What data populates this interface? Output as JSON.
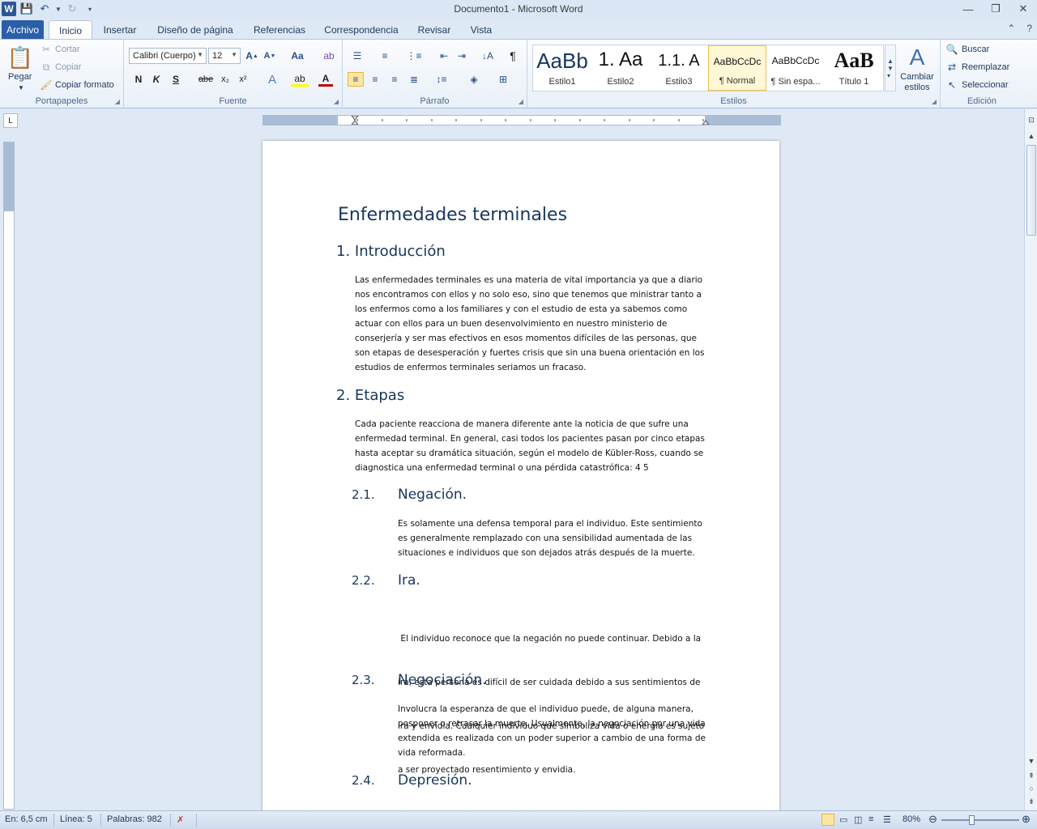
{
  "window": {
    "title": "Documento1 - Microsoft Word"
  },
  "quick_access": {
    "app_icon": "word-icon",
    "save_icon": "save-icon",
    "undo_icon": "undo-icon",
    "redo_icon": "redo-icon",
    "customize_icon": "chevron-down-icon"
  },
  "window_controls": {
    "minimize": "▭",
    "restore": "❐",
    "close": "✕"
  },
  "tabs": [
    {
      "label": "Archivo"
    },
    {
      "label": "Inicio"
    },
    {
      "label": "Insertar"
    },
    {
      "label": "Diseño de página"
    },
    {
      "label": "Referencias"
    },
    {
      "label": "Correspondencia"
    },
    {
      "label": "Revisar"
    },
    {
      "label": "Vista"
    }
  ],
  "ribbon": {
    "clipboard": {
      "paste": "Pegar",
      "cut": "Cortar",
      "copy": "Copiar",
      "format_painter": "Copiar formato",
      "label": "Portapapeles"
    },
    "font": {
      "name": "Calibri (Cuerpo)",
      "size": "12",
      "label": "Fuente",
      "bold": "N",
      "italic": "K",
      "underline": "S",
      "strike": "abe",
      "subscript": "x₂",
      "superscript": "x²",
      "change_case": "Aa"
    },
    "paragraph": {
      "label": "Párrafo",
      "pilcrow": "¶"
    },
    "styles": {
      "label": "Estilos",
      "items": [
        {
          "sample": "AaBb",
          "name": "Estilo1"
        },
        {
          "sample": "1.",
          "name": "Estilo2"
        },
        {
          "sample": "1.1.",
          "name": "Estilo3"
        },
        {
          "sample": "AaBbCcDc",
          "name": "¶ Normal"
        },
        {
          "sample": "AaBbCcDc",
          "name": "¶ Sin espa..."
        },
        {
          "sample": "AaB",
          "name": "Título 1"
        }
      ],
      "change_styles": "Cambiar estilos"
    },
    "editing": {
      "find": "Buscar",
      "replace": "Reemplazar",
      "select": "Seleccionar",
      "label": "Edición"
    }
  },
  "document": {
    "title": "Enfermedades terminales",
    "sections": {
      "intro_heading": "1. Introducción",
      "intro_lines": [
        "Las enfermedades terminales es una materia de vital importancia ya que a diario",
        "nos encontramos con ellos y no solo eso, sino que tenemos que ministrar tanto a",
        "los enfermos como a los familiares y con el estudio de esta ya sabemos como",
        "actuar con ellos para un buen desenvolvimiento en nuestro ministerio de",
        "conserjería y ser mas efectivos en esos momentos difíciles de las personas, que",
        "son etapas de desesperación y fuertes crisis que sin una buena orientación en los",
        "estudios de enfermos terminales seriamos un fracaso."
      ],
      "stages_heading": "2. Etapas",
      "stages_lines": [
        "Cada paciente reacciona de manera diferente ante la noticia de que sufre una",
        "enfermedad terminal. En general, casi todos los pacientes pasan por cinco etapas",
        "hasta aceptar su dramática situación, según el modelo de Kübler-Ross, cuando se",
        "diagnostica una enfermedad terminal o una pérdida catastrófica: 4 5"
      ],
      "s21_num": "2.1.",
      "s21_title": "Negación.",
      "s21_lines": [
        "Es solamente una defensa temporal para el individuo. Este sentimiento",
        "es generalmente remplazado con una sensibilidad aumentada de las",
        "situaciones e individuos que son dejados atrás después de la muerte."
      ],
      "s22_num": "2.2.",
      "s22_title": "Ira.",
      "s22_lines": [
        " El individuo reconoce que la negación no puede continuar. Debido a la",
        "ira, esta persona es difícil de ser cuidada debido a sus sentimientos de",
        "ira y envidia. Cualquier individuo que simboliza vida o energía es sujeto",
        "a ser proyectado resentimiento y envidia."
      ],
      "s23_num": "2.3.",
      "s23_title": "Negociación.",
      "s23_lines": [
        "Involucra la esperanza de que el individuo puede, de alguna manera,",
        "posponer o retrasar la muerte. Usualmente, la negociación por una vida",
        "extendida es realizada con un poder superior a cambio de una forma de",
        "vida reformada."
      ],
      "s24_num": "2.4.",
      "s24_title": "Depresión."
    }
  },
  "statusbar": {
    "position": "En: 6,5 cm",
    "line": "Línea: 5",
    "words": "Palabras: 982",
    "zoom": "80%"
  }
}
